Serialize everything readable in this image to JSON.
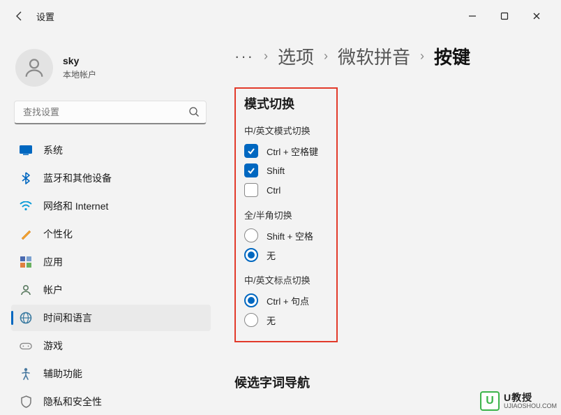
{
  "titlebar": {
    "title": "设置"
  },
  "user": {
    "name": "sky",
    "sub": "本地帐户"
  },
  "search": {
    "placeholder": "查找设置"
  },
  "nav": {
    "items": [
      {
        "label": "系统"
      },
      {
        "label": "蓝牙和其他设备"
      },
      {
        "label": "网络和 Internet"
      },
      {
        "label": "个性化"
      },
      {
        "label": "应用"
      },
      {
        "label": "帐户"
      },
      {
        "label": "时间和语言"
      },
      {
        "label": "游戏"
      },
      {
        "label": "辅助功能"
      },
      {
        "label": "隐私和安全性"
      }
    ]
  },
  "breadcrumb": {
    "dots": "···",
    "items": [
      "选项",
      "微软拼音",
      "按键"
    ]
  },
  "section": {
    "title": "模式切换",
    "group1": {
      "head": "中/英文模式切换",
      "opt1": "Ctrl + 空格键",
      "opt2": "Shift",
      "opt3": "Ctrl"
    },
    "group2": {
      "head": "全/半角切换",
      "opt1": "Shift + 空格",
      "opt2": "无"
    },
    "group3": {
      "head": "中/英文标点切换",
      "opt1": "Ctrl + 句点",
      "opt2": "无"
    }
  },
  "next_section": "候选字词导航",
  "watermark": {
    "cn": "U教授",
    "url": "UJIAOSHOU.COM"
  }
}
